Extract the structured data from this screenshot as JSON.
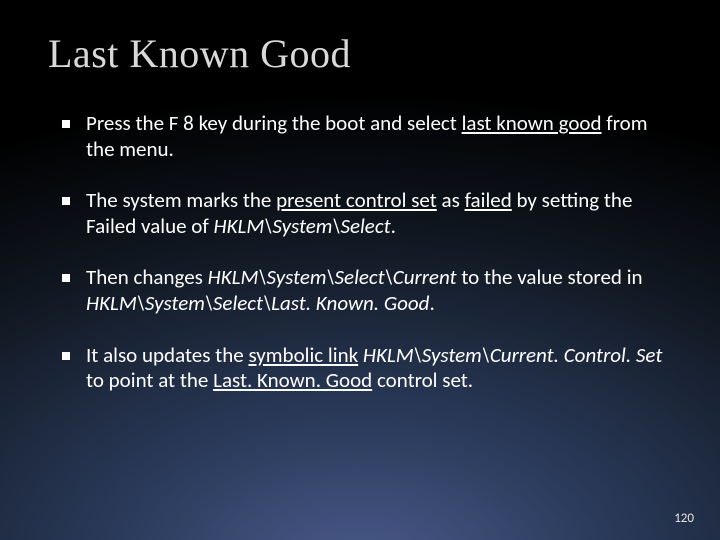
{
  "slide": {
    "title": "Last Known Good",
    "number": "120",
    "bullets": [
      {
        "t1": "Press the F 8 key during the boot and select ",
        "u1": "last known good",
        "t2": " from the menu."
      },
      {
        "t1": "The system marks the ",
        "u1": "present control set",
        "t2": " as ",
        "u2": "failed",
        "t3": " by setting the Failed value of ",
        "i1": "HKLM\\System\\Select",
        "t4": "."
      },
      {
        "t1": "Then changes ",
        "i1": "HKLM\\System\\Select\\Current",
        "t2": " to the value stored in ",
        "i2": "HKLM\\System\\Select\\Last. Known. Good",
        "t3": "."
      },
      {
        "t1": "It also updates the  ",
        "u1": "symbolic link",
        "t2": " ",
        "i1": "HKLM\\System\\Current. Control. Set",
        "t3": " to point at the ",
        "u2": "Last. Known. Good",
        "t4": " control set."
      }
    ]
  }
}
